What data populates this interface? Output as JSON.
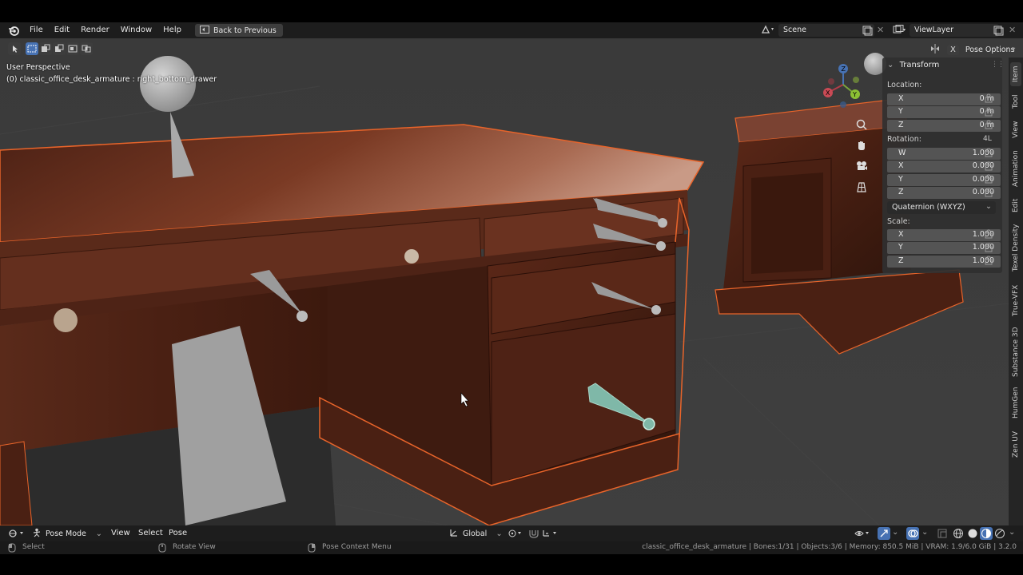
{
  "menu": {
    "items": [
      "File",
      "Edit",
      "Render",
      "Window",
      "Help"
    ],
    "back_button": "Back to Previous"
  },
  "scene": {
    "name": "Scene",
    "view_layer": "ViewLayer"
  },
  "header": {
    "pose_options": "Pose Options"
  },
  "viewport": {
    "perspective": "User Perspective",
    "active_object": "(0) classic_office_desk_armature : right_bottom_drawer"
  },
  "transform_panel": {
    "title": "Transform",
    "location_label": "Location:",
    "location": [
      {
        "axis": "X",
        "value": "0 m"
      },
      {
        "axis": "Y",
        "value": "0 m"
      },
      {
        "axis": "Z",
        "value": "0 m"
      }
    ],
    "rotation_label": "Rotation:",
    "rotation_mode_short": "4L",
    "rotation": [
      {
        "axis": "W",
        "value": "1.000"
      },
      {
        "axis": "X",
        "value": "0.000"
      },
      {
        "axis": "Y",
        "value": "0.000"
      },
      {
        "axis": "Z",
        "value": "0.000"
      }
    ],
    "rotation_mode": "Quaternion (WXYZ)",
    "scale_label": "Scale:",
    "scale": [
      {
        "axis": "X",
        "value": "1.000"
      },
      {
        "axis": "Y",
        "value": "1.000"
      },
      {
        "axis": "Z",
        "value": "1.000"
      }
    ]
  },
  "side_tabs": [
    "Item",
    "Tool",
    "View",
    "Animation",
    "Edit",
    "Texel Density",
    "True-VFX",
    "Substance 3D",
    "HumGen",
    "Zen UV"
  ],
  "footer": {
    "mode": "Pose Mode",
    "menus": [
      "View",
      "Select",
      "Pose"
    ],
    "orientation": "Global"
  },
  "statusbar": {
    "select": "Select",
    "rotate": "Rotate View",
    "context": "Pose Context Menu",
    "info": "classic_office_desk_armature | Bones:1/31 | Objects:3/6 | Memory: 850.5 MiB | VRAM: 1.9/6.0 GiB | 3.2.0"
  },
  "colors": {
    "accent_blue": "#4772b3",
    "selection_outline": "#e8642a",
    "active_bone": "#7fb8a8",
    "wood_dark": "#3a1a10",
    "wood_mid": "#6b2e1c"
  }
}
